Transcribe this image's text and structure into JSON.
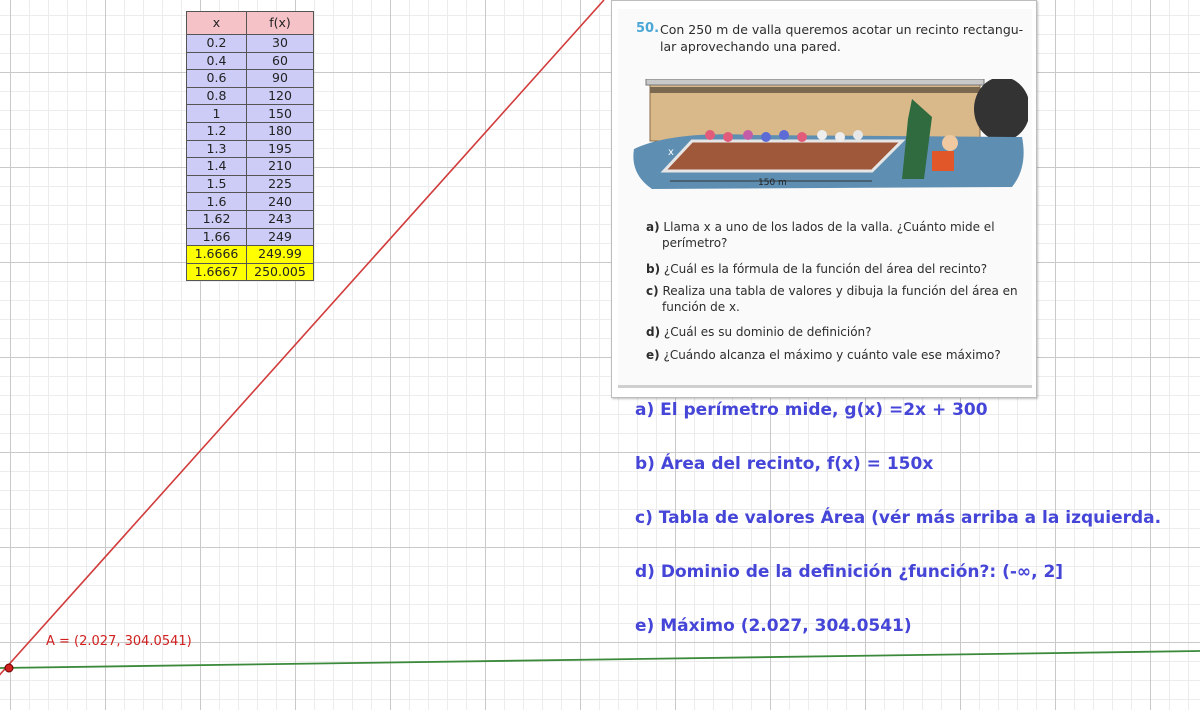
{
  "value_table": {
    "headers": [
      "x",
      "f(x)"
    ],
    "rows": [
      {
        "x": "0.2",
        "fx": "30"
      },
      {
        "x": "0.4",
        "fx": "60"
      },
      {
        "x": "0.6",
        "fx": "90"
      },
      {
        "x": "0.8",
        "fx": "120"
      },
      {
        "x": "1",
        "fx": "150"
      },
      {
        "x": "1.2",
        "fx": "180"
      },
      {
        "x": "1.3",
        "fx": "195"
      },
      {
        "x": "1.4",
        "fx": "210"
      },
      {
        "x": "1.5",
        "fx": "225"
      },
      {
        "x": "1.6",
        "fx": "240"
      },
      {
        "x": "1.62",
        "fx": "243"
      },
      {
        "x": "1.66",
        "fx": "249"
      },
      {
        "x": "1.6666",
        "fx": "249.99",
        "highlight": true
      },
      {
        "x": "1.6667",
        "fx": "250.005",
        "highlight": true
      }
    ],
    "colors": {
      "header": "#f4c2c7",
      "cell": "#ccccf7",
      "highlight": "#ffff00"
    }
  },
  "book": {
    "number": "50.",
    "question_line1": "Con 250 m de valla queremos acotar un recinto rectangu-",
    "question_line2": "lar aprovechando una pared.",
    "label_x": "x",
    "label_150": "150 m",
    "items": [
      {
        "letter": "a)",
        "line1": "Llama x a uno de los lados de la valla. ¿Cuánto mide el",
        "line2": "perímetro?"
      },
      {
        "letter": "b)",
        "line1": "¿Cuál es la fórmula de la función del área del recinto?",
        "line2": ""
      },
      {
        "letter": "c)",
        "line1": "Realiza una tabla de valores y dibuja la función del área en",
        "line2": "función de x."
      },
      {
        "letter": "d)",
        "line1": "¿Cuál es su dominio de definición?",
        "line2": ""
      },
      {
        "letter": "e)",
        "line1": "¿Cuándo alcanza el máximo y cuánto vale ese máximo?",
        "line2": ""
      }
    ]
  },
  "answers": {
    "a": "a) El perímetro mide,  g(x) =2x + 300",
    "b": "b) Área del recinto,  f(x) = 150x",
    "c": "c) Tabla de valores Área (vér más arriba a la izquierda.",
    "d": "d) Dominio de la definición ¿función?: (-∞, 2]",
    "e": "e) Máximo (2.027, 304.0541)"
  },
  "point": {
    "label": "A = (2.027, 304.0541)",
    "color": "#d02020"
  },
  "lines": {
    "f_color": "#d23b3b",
    "g_color": "#3b8a3b"
  }
}
